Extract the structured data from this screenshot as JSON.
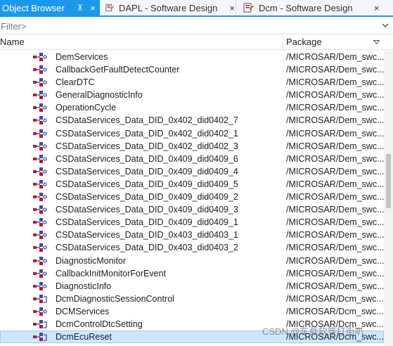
{
  "tabs": [
    {
      "label": "Object Browser",
      "pin": "⊼",
      "close": "×",
      "active": true
    },
    {
      "label": "DAPL - Software Design",
      "close": "×",
      "active": false
    },
    {
      "label": "Dcm - Software Design",
      "close": "×",
      "active": false
    }
  ],
  "filter": {
    "placeholder": "Filter>",
    "value": ""
  },
  "columns": {
    "name": "Name",
    "package": "Package"
  },
  "rows": [
    {
      "name": "DemServices",
      "package": "/MICROSAR/Dem_swc...",
      "icon": "client-server-interface-icon"
    },
    {
      "name": "CallbackGetFaultDetectCounter",
      "package": "/MICROSAR/Dem_swc...",
      "icon": "client-server-interface-icon"
    },
    {
      "name": "ClearDTC",
      "package": "/MICROSAR/Dem_swc...",
      "icon": "client-server-interface-icon"
    },
    {
      "name": "GeneralDiagnosticInfo",
      "package": "/MICROSAR/Dem_swc...",
      "icon": "client-server-interface-icon"
    },
    {
      "name": "OperationCycle",
      "package": "/MICROSAR/Dem_swc...",
      "icon": "client-server-interface-icon"
    },
    {
      "name": "CSDataServices_Data_DID_0x402_did0402_7",
      "package": "/MICROSAR/Dem_swc...",
      "icon": "client-server-interface-icon"
    },
    {
      "name": "CSDataServices_Data_DID_0x402_did0402_1",
      "package": "/MICROSAR/Dem_swc...",
      "icon": "client-server-interface-icon"
    },
    {
      "name": "CSDataServices_Data_DID_0x402_did0402_3",
      "package": "/MICROSAR/Dem_swc...",
      "icon": "client-server-interface-icon"
    },
    {
      "name": "CSDataServices_Data_DID_0x409_did0409_6",
      "package": "/MICROSAR/Dem_swc...",
      "icon": "client-server-interface-icon"
    },
    {
      "name": "CSDataServices_Data_DID_0x409_did0409_4",
      "package": "/MICROSAR/Dem_swc...",
      "icon": "client-server-interface-icon"
    },
    {
      "name": "CSDataServices_Data_DID_0x409_did0409_5",
      "package": "/MICROSAR/Dem_swc...",
      "icon": "client-server-interface-icon"
    },
    {
      "name": "CSDataServices_Data_DID_0x409_did0409_2",
      "package": "/MICROSAR/Dem_swc...",
      "icon": "client-server-interface-icon"
    },
    {
      "name": "CSDataServices_Data_DID_0x409_did0409_3",
      "package": "/MICROSAR/Dem_swc...",
      "icon": "client-server-interface-icon"
    },
    {
      "name": "CSDataServices_Data_DID_0x409_did0409_1",
      "package": "/MICROSAR/Dem_swc...",
      "icon": "client-server-interface-icon"
    },
    {
      "name": "CSDataServices_Data_DID_0x403_did0403_1",
      "package": "/MICROSAR/Dem_swc...",
      "icon": "client-server-interface-icon"
    },
    {
      "name": "CSDataServices_Data_DID_0x403_did0403_2",
      "package": "/MICROSAR/Dem_swc...",
      "icon": "client-server-interface-icon"
    },
    {
      "name": "DiagnosticMonitor",
      "package": "/MICROSAR/Dem_swc...",
      "icon": "client-server-interface-icon"
    },
    {
      "name": "CallbackInitMonitorForEvent",
      "package": "/MICROSAR/Dem_swc...",
      "icon": "client-server-interface-icon"
    },
    {
      "name": "DiagnosticInfo",
      "package": "/MICROSAR/Dem_swc...",
      "icon": "client-server-interface-icon"
    },
    {
      "name": "DcmDiagnosticSessionControl",
      "package": "/MICROSAR/Dcm_swc...",
      "icon": "mode-switch-interface-icon"
    },
    {
      "name": "DCMServices",
      "package": "/MICROSAR/Dcm_swc...",
      "icon": "client-server-interface-icon"
    },
    {
      "name": "DcmControlDtcSetting",
      "package": "/MICROSAR/Dcm_swc...",
      "icon": "mode-switch-interface-icon"
    },
    {
      "name": "DcmEcuReset",
      "package": "/MICROSAR/Dcm_swc...",
      "icon": "mode-switch-interface-icon",
      "selected": true
    }
  ],
  "watermark": "CSDN @车载软笌打街叭",
  "colors": {
    "accent": "#1c97ea",
    "selection": "#cce8ff",
    "icon_red": "#c8102e",
    "icon_blue": "#3b4fa0"
  }
}
